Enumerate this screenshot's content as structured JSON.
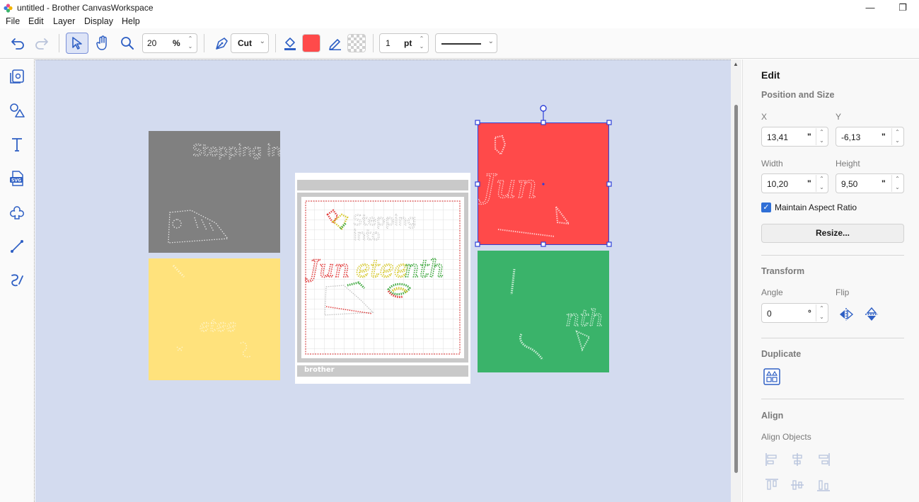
{
  "window": {
    "title": "untitled - Brother CanvasWorkspace",
    "minimize": "—",
    "maximize": "❐"
  },
  "menu": [
    "File",
    "Edit",
    "Layer",
    "Display",
    "Help"
  ],
  "toolbar": {
    "zoom_value": "20",
    "zoom_unit": "%",
    "tool_mode": "Cut",
    "fill_color": "#ff4a4a",
    "line_width_value": "1",
    "line_width_unit": "pt"
  },
  "canvas": {
    "background": "#d3dbef",
    "mat_brand": "brother",
    "panels": [
      {
        "color": "#808080",
        "text": "Stepping into"
      },
      {
        "color": "#ffe27c",
        "text": "etee"
      },
      {
        "color": "#ff4a4a",
        "text": "Jun"
      },
      {
        "color": "#3ab36a",
        "text": "nth"
      }
    ],
    "mat_design": {
      "line1": "Stepping",
      "line2": "into",
      "word": [
        "Jun",
        "etee",
        "nth"
      ]
    }
  },
  "edit_panel": {
    "title": "Edit",
    "position_size": {
      "heading": "Position and Size",
      "x_label": "X",
      "x_value": "13,41",
      "y_label": "Y",
      "y_value": "-6,13",
      "width_label": "Width",
      "width_value": "10,20",
      "height_label": "Height",
      "height_value": "9,50",
      "unit": "\"",
      "aspect_label": "Maintain Aspect Ratio",
      "aspect_checked": true,
      "resize_label": "Resize..."
    },
    "transform": {
      "heading": "Transform",
      "angle_label": "Angle",
      "angle_value": "0",
      "angle_unit": "°",
      "flip_label": "Flip"
    },
    "duplicate": {
      "heading": "Duplicate"
    },
    "align": {
      "heading": "Align",
      "sub": "Align Objects"
    }
  },
  "colors": {
    "accent": "#2f6fd6",
    "icon": "#2e5fc4"
  }
}
